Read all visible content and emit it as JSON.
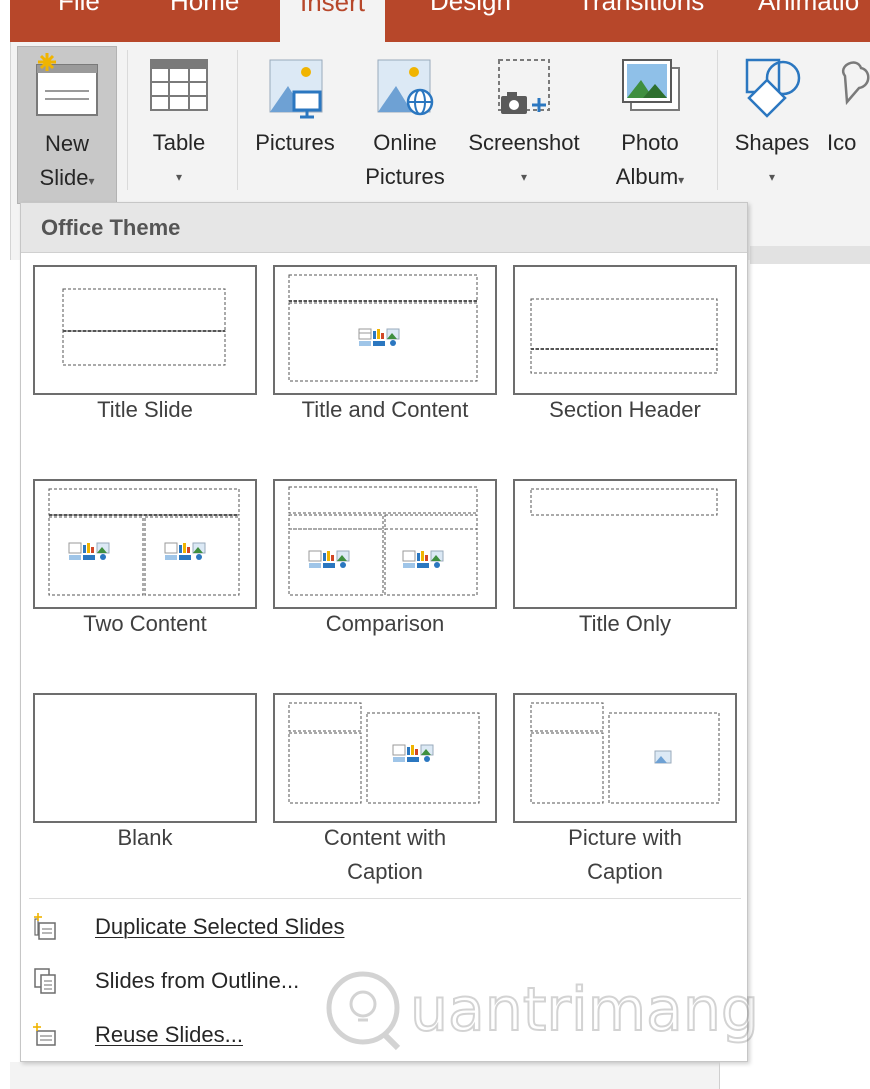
{
  "tabs": [
    {
      "label": "File"
    },
    {
      "label": "Home"
    },
    {
      "label": "Insert",
      "active": true
    },
    {
      "label": "Design"
    },
    {
      "label": "Transitions"
    },
    {
      "label": "Animatio"
    }
  ],
  "ribbon": {
    "new_slide": {
      "line1": "New",
      "line2": "Slide",
      "arrow": "▾",
      "icon": "new-slide-icon"
    },
    "table": {
      "line1": "Table",
      "arrow": "▾",
      "icon": "table-icon"
    },
    "pictures": {
      "line1": "Pictures",
      "icon": "pictures-icon"
    },
    "online_pictures": {
      "line1": "Online",
      "line2": "Pictures",
      "icon": "online-pictures-icon"
    },
    "screenshot": {
      "line1": "Screenshot",
      "arrow": "▾",
      "icon": "screenshot-icon"
    },
    "photo_album": {
      "line1": "Photo",
      "line2": "Album",
      "arrow": "▾",
      "icon": "photo-album-icon"
    },
    "shapes": {
      "line1": "Shapes",
      "arrow": "▾",
      "icon": "shapes-icon"
    },
    "icons": {
      "line1": "Ico",
      "icon": "icons-icon"
    }
  },
  "gallery": {
    "header": "Office Theme",
    "layouts": [
      {
        "label": "Title Slide"
      },
      {
        "label": "Title and Content"
      },
      {
        "label": "Section Header"
      },
      {
        "label": "Two Content"
      },
      {
        "label": "Comparison"
      },
      {
        "label": "Title Only"
      },
      {
        "label": "Blank"
      },
      {
        "label_line1": "Content with",
        "label_line2": "Caption"
      },
      {
        "label_line1": "Picture with",
        "label_line2": "Caption"
      }
    ],
    "footer": [
      {
        "label": "Duplicate Selected Slides",
        "icon": "duplicate-slides-icon"
      },
      {
        "label": "Slides from Outline...",
        "icon": "slides-from-outline-icon"
      },
      {
        "label": "Reuse Slides...",
        "icon": "reuse-slides-icon"
      }
    ]
  },
  "watermark": {
    "text": "uantrimang"
  },
  "colors": {
    "accent": "#b7472a",
    "ribbon_bg": "#f3f3f3",
    "selected_bg": "#c8c8c8"
  }
}
